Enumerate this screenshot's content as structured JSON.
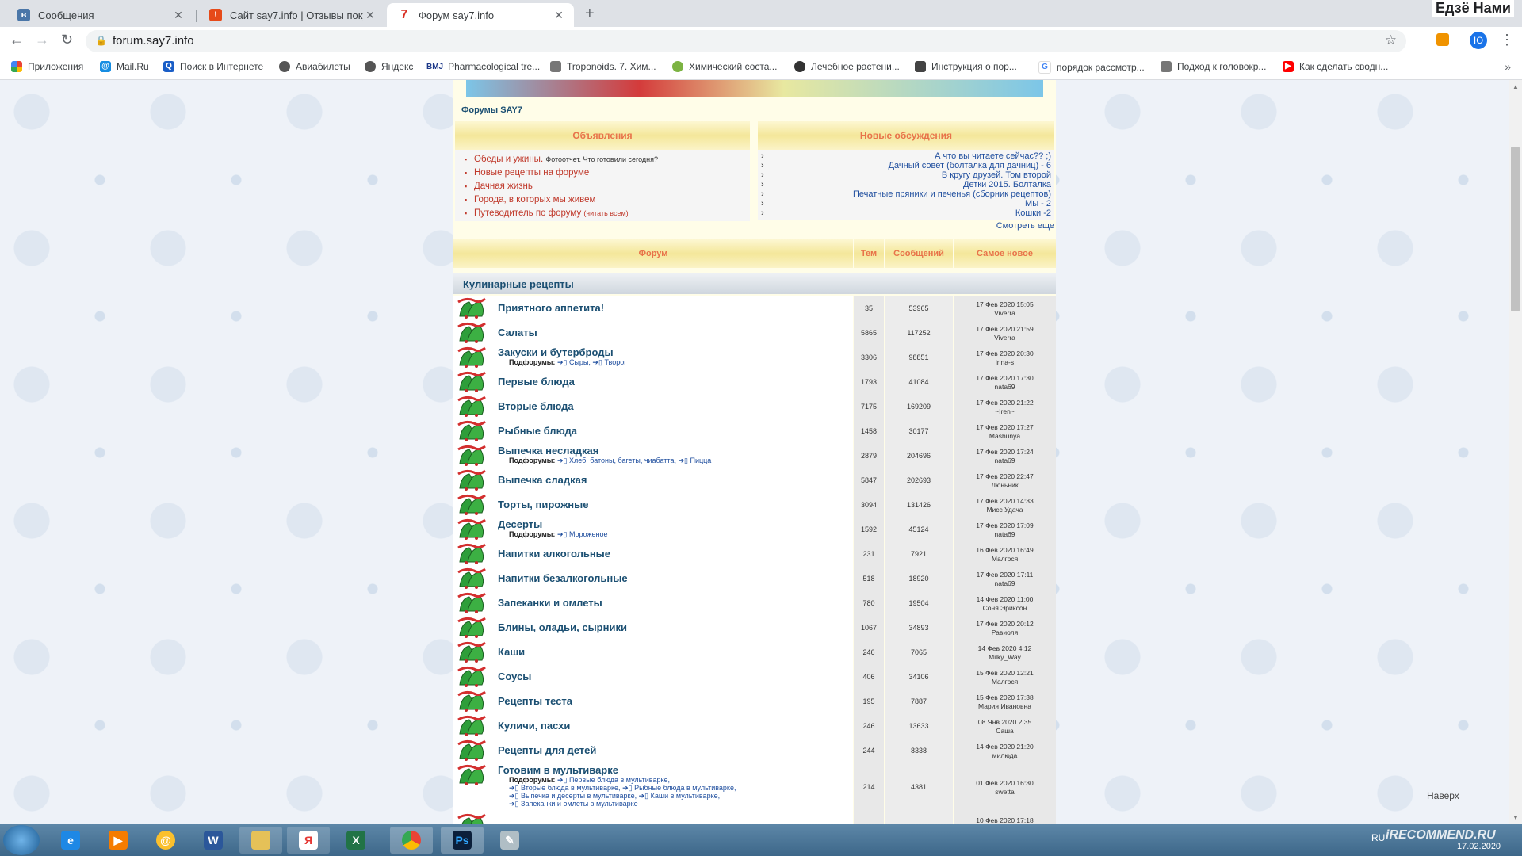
{
  "browser": {
    "tabs": [
      {
        "title": "Сообщения",
        "icon": "vk-icon",
        "color": "#4a76a8"
      },
      {
        "title": "Сайт say7.info | Отзывы покупат",
        "icon": "otzovik-icon",
        "color": "#e64a19"
      },
      {
        "title": "Форум say7.info",
        "icon": "say7-icon",
        "color": "#d93025"
      }
    ],
    "window_user": "Едзё Нами",
    "url": "forum.say7.info",
    "profile_letter": "Ю",
    "bookmarks": [
      {
        "label": "Приложения",
        "icon": "apps-grid-icon"
      },
      {
        "label": "Mail.Ru",
        "icon": "mailru-icon"
      },
      {
        "label": "Поиск в Интернете",
        "icon": "search-icon"
      },
      {
        "label": "Авиабилеты",
        "icon": "globe-icon"
      },
      {
        "label": "Яндекс",
        "icon": "globe-icon"
      },
      {
        "label": "Pharmacological tre...",
        "icon": "bmj-icon",
        "prefix": "BMJ"
      },
      {
        "label": "Troponoids. 7. Хим...",
        "icon": "link-icon"
      },
      {
        "label": "Химический соста...",
        "icon": "leaf-icon"
      },
      {
        "label": "Лечебное растени...",
        "icon": "plant-icon"
      },
      {
        "label": "Инструкция о пор...",
        "icon": "document-icon"
      },
      {
        "label": "порядок рассмотр...",
        "icon": "google-icon"
      },
      {
        "label": "Подход к головокр...",
        "icon": "link-icon"
      },
      {
        "label": "Как сделать сводн...",
        "icon": "youtube-icon"
      }
    ]
  },
  "page": {
    "forums_title": "Форумы SAY7",
    "announcements_title": "Объявления",
    "announcements": [
      {
        "text": "Обеды и ужины.",
        "note": "Фотоотчет. Что готовили сегодня?",
        "note_red": false
      },
      {
        "text": "Новые рецепты на форуме",
        "note": "",
        "note_red": false
      },
      {
        "text": "Дачная жизнь",
        "note": "",
        "note_red": false
      },
      {
        "text": "Города, в которых мы живем",
        "note": "",
        "note_red": false
      },
      {
        "text": "Путеводитель по форуму",
        "note": "(читать всем)",
        "note_red": true
      }
    ],
    "discussions_title": "Новые обсуждения",
    "discussions": [
      "А что вы читаете сейчас?? ;)",
      "Дачный совет (болталка для дачниц) - 6",
      "В кругу друзей. Том второй",
      "Детки 2015. Болталка",
      "Печатные пряники и печенья (сборник рецептов)",
      "Мы - 2",
      "Кошки -2"
    ],
    "more_link": "Смотреть еще",
    "table_headers": {
      "forum": "Форум",
      "topics": "Тем",
      "posts": "Сообщений",
      "latest": "Самое новое"
    },
    "category": "Кулинарные рецепты",
    "subforums_label": "Подфорумы:",
    "back_to_top": "Наверх",
    "forums": [
      {
        "name": "Приятного аппетита!",
        "topics": "35",
        "posts": "53965",
        "date": "17 Фев 2020 15:05",
        "user": "Viverra"
      },
      {
        "name": "Салаты",
        "topics": "5865",
        "posts": "117252",
        "date": "17 Фев 2020 21:59",
        "user": "Viverra"
      },
      {
        "name": "Закуски и бутерброды",
        "topics": "3306",
        "posts": "98851",
        "date": "17 Фев 2020 20:30",
        "user": "irina-s",
        "subforums": [
          "Сыры,",
          "Творог"
        ]
      },
      {
        "name": "Первые блюда",
        "topics": "1793",
        "posts": "41084",
        "date": "17 Фев 2020 17:30",
        "user": "nata69"
      },
      {
        "name": "Вторые блюда",
        "topics": "7175",
        "posts": "169209",
        "date": "17 Фев 2020 21:22",
        "user": "~Iren~"
      },
      {
        "name": "Рыбные блюда",
        "topics": "1458",
        "posts": "30177",
        "date": "17 Фев 2020 17:27",
        "user": "Mashunya"
      },
      {
        "name": "Выпечка несладкая",
        "topics": "2879",
        "posts": "204696",
        "date": "17 Фев 2020 17:24",
        "user": "nata69",
        "subforums": [
          "Хлеб, батоны, багеты, чиабатта,",
          "Пицца"
        ]
      },
      {
        "name": "Выпечка сладкая",
        "topics": "5847",
        "posts": "202693",
        "date": "17 Фев 2020 22:47",
        "user": "Люньник"
      },
      {
        "name": "Торты, пирожные",
        "topics": "3094",
        "posts": "131426",
        "date": "17 Фев 2020 14:33",
        "user": "Мисс Удача"
      },
      {
        "name": "Десерты",
        "topics": "1592",
        "posts": "45124",
        "date": "17 Фев 2020 17:09",
        "user": "nata69",
        "subforums": [
          "Мороженое"
        ]
      },
      {
        "name": "Напитки алкогольные",
        "topics": "231",
        "posts": "7921",
        "date": "16 Фев 2020 16:49",
        "user": "Малгося"
      },
      {
        "name": "Напитки безалкогольные",
        "topics": "518",
        "posts": "18920",
        "date": "17 Фев 2020 17:11",
        "user": "nata69"
      },
      {
        "name": "Запеканки и омлеты",
        "topics": "780",
        "posts": "19504",
        "date": "14 Фев 2020 11:00",
        "user": "Соня Эриксон"
      },
      {
        "name": "Блины, оладьи, сырники",
        "topics": "1067",
        "posts": "34893",
        "date": "17 Фев 2020 20:12",
        "user": "Равиоля"
      },
      {
        "name": "Каши",
        "topics": "246",
        "posts": "7065",
        "date": "14 Фев 2020 4:12",
        "user": "Milky_Way"
      },
      {
        "name": "Соусы",
        "topics": "406",
        "posts": "34106",
        "date": "15 Фев 2020 12:21",
        "user": "Малгося"
      },
      {
        "name": "Рецепты теста",
        "topics": "195",
        "posts": "7887",
        "date": "15 Фев 2020 17:38",
        "user": "Мария Ивановна"
      },
      {
        "name": "Куличи, пасхи",
        "topics": "246",
        "posts": "13633",
        "date": "08 Янв 2020 2:35",
        "user": "Саша"
      },
      {
        "name": "Рецепты для детей",
        "topics": "244",
        "posts": "8338",
        "date": "14 Фев 2020 21:20",
        "user": "милюда"
      },
      {
        "name": "Готовим в мультиварке",
        "topics": "214",
        "posts": "4381",
        "date": "01 Фев 2020 16:30",
        "user": "swetta",
        "subforums": [
          "Первые блюда в мультиварке,",
          "Вторые блюда в мультиварке,",
          "Рыбные блюда в мультиварке,",
          "Выпечка и десерты в мультиварке,",
          "Каши в мультиварке,",
          "Запеканки и омлеты в мультиварке"
        ]
      },
      {
        "name": "",
        "topics": "",
        "posts": "",
        "date": "10 Фев 2020 17:18",
        "user": ""
      }
    ]
  },
  "taskbar": {
    "apps": [
      "ie-icon",
      "media-player-icon",
      "mail-agent-icon",
      "word-icon",
      "explorer-icon",
      "yandex-browser-icon",
      "excel-icon",
      "chrome-icon",
      "photoshop-icon",
      "paint-icon"
    ],
    "lang": "RU",
    "date": "17.02.2020",
    "watermark": "iRECOMMEND.RU"
  }
}
